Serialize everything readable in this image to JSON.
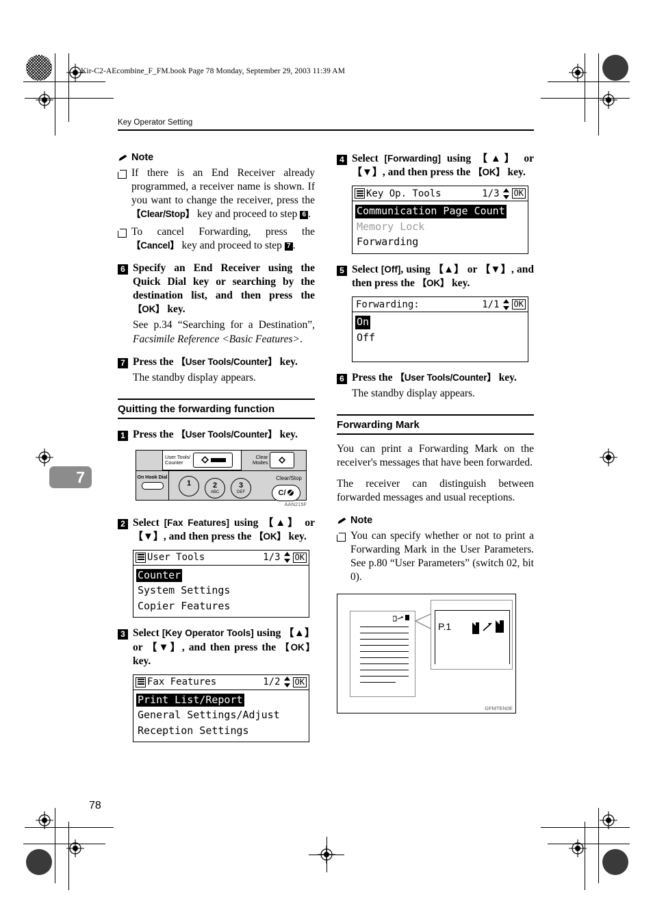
{
  "file_bar": "Kir-C2-AEcombine_F_FM.book  Page 78  Monday, September 29, 2003  11:39 AM",
  "running_head": "Key Operator Setting",
  "chapter_tab": "7",
  "page_number": "78",
  "left_column": {
    "note_label": "Note",
    "notes": [
      "If there is an End Receiver already programmed, a receiver name is shown. If you want to change the receiver, press the 【Clear/Stop】 key and proceed to step 6.",
      "To cancel Forwarding, press the 【Cancel】 key and proceed to step 7."
    ],
    "note1_pre": "If there is an End Receiver already programmed, a receiver name is shown. If you want to change the receiver, press the ",
    "note1_key": "【Clear/Stop】",
    "note1_mid": " key and proceed to step ",
    "note1_step": "6",
    "note2_pre": "To cancel Forwarding, press the ",
    "note2_key": "【Cancel】",
    "note2_mid": " key and proceed to step ",
    "note2_step": "7",
    "step6_num": "6",
    "step6_pre": "Specify an End Receiver using the Quick Dial key or searching by the destination list, and then press the ",
    "step6_key": "【OK】",
    "step6_post": " key.",
    "step6_ref_pre": "See p.34 “Searching for a Destination”, ",
    "step6_ref_ital": "Facsimile Reference <Basic Features>",
    "step6_ref_post": ".",
    "step7_num": "7",
    "step7_pre": "Press the ",
    "step7_key": "【User Tools/Counter】",
    "step7_post": " key.",
    "step7_sub": "The standby display appears.",
    "section_heading": "Quitting the forwarding function",
    "q_step1_num": "1",
    "q_step1_pre": "Press the ",
    "q_step1_key": "【User Tools/Counter】",
    "q_step1_post": " key.",
    "panel": {
      "user_tools_label_l1": "User Tools/",
      "user_tools_label_l2": "Counter",
      "clear_modes_l1": "Clear",
      "clear_modes_l2": "Modes",
      "on_hook_dial": "On Hook Dial",
      "key1_num": "1",
      "key1_sub": "",
      "key2_num": "2",
      "key2_sub": "ABC",
      "key3_num": "3",
      "key3_sub": "DEF",
      "clear_stop_label": "Clear/Stop",
      "clear_stop_key": "C/",
      "fig_code": "AAN215F"
    },
    "q_step2_num": "2",
    "q_step2_a": "Select ",
    "q_step2_b": "[Fax Features]",
    "q_step2_c": " using ",
    "q_step2_d": "【▲】",
    "q_step2_e": " or ",
    "q_step2_f": "【▼】",
    "q_step2_g": ", and then press the ",
    "q_step2_h": "【OK】",
    "q_step2_i": " key.",
    "lcd1": {
      "title": "User Tools",
      "page": "1/3",
      "ok": "OK",
      "rows": [
        {
          "text": "Counter",
          "state": "selected"
        },
        {
          "text": "System Settings",
          "state": "normal"
        },
        {
          "text": "Copier Features",
          "state": "normal"
        }
      ]
    },
    "q_step3_num": "3",
    "q_step3_a": "Select ",
    "q_step3_b": "[Key Operator Tools]",
    "q_step3_c": " using ",
    "q_step3_d": "【▲】",
    "q_step3_e": " or ",
    "q_step3_f": "【▼】",
    "q_step3_g": ", and then press the ",
    "q_step3_h": "【OK】",
    "q_step3_i": " key.",
    "lcd2": {
      "title": "Fax Features",
      "page": "1/2",
      "ok": "OK",
      "rows": [
        {
          "text": "Print List/Report",
          "state": "selected"
        },
        {
          "text": "General Settings/Adjust",
          "state": "normal"
        },
        {
          "text": "Reception Settings",
          "state": "normal"
        }
      ]
    }
  },
  "right_column": {
    "step4_num": "4",
    "step4_a": "Select ",
    "step4_b": "[Forwarding]",
    "step4_c": " using ",
    "step4_d": "【▲】",
    "step4_e": " or ",
    "step4_f": "【▼】",
    "step4_g": ", and then press the ",
    "step4_h": "【OK】",
    "step4_i": " key.",
    "lcd3": {
      "title": "Key Op. Tools",
      "page": "1/3",
      "ok": "OK",
      "rows": [
        {
          "text": "Communication Page Count",
          "state": "selected"
        },
        {
          "text": "Memory Lock",
          "state": "dimmed"
        },
        {
          "text": "Forwarding",
          "state": "normal"
        }
      ]
    },
    "step5_num": "5",
    "step5_a": "Select ",
    "step5_b": "[Off]",
    "step5_c": ", using ",
    "step5_d": "【▲】",
    "step5_e": " or ",
    "step5_f": "【▼】",
    "step5_g": ", and then press the ",
    "step5_h": "【OK】",
    "step5_i": " key.",
    "lcd4": {
      "title": "Forwarding:",
      "page": "1/1",
      "ok": "OK",
      "rows": [
        {
          "text": "On",
          "state": "selected"
        },
        {
          "text": "Off",
          "state": "normal"
        }
      ]
    },
    "step6_num": "6",
    "step6_pre": "Press the ",
    "step6_key": "【User Tools/Counter】",
    "step6_post": " key.",
    "step6_sub": "The standby display appears.",
    "section_heading": "Forwarding Mark",
    "para1": "You can print a Forwarding Mark on the receiver's messages that have been forwarded.",
    "para2": "The receiver can distinguish between forwarded messages and usual receptions.",
    "note_label": "Note",
    "note1": "You can specify whether or not to print a Forwarding Mark in the User Parameters. See p.80 “User Parameters” (switch 02, bit 0).",
    "figure": {
      "callout_text": "P.1",
      "fig_code": "GFMTEN0E"
    }
  }
}
